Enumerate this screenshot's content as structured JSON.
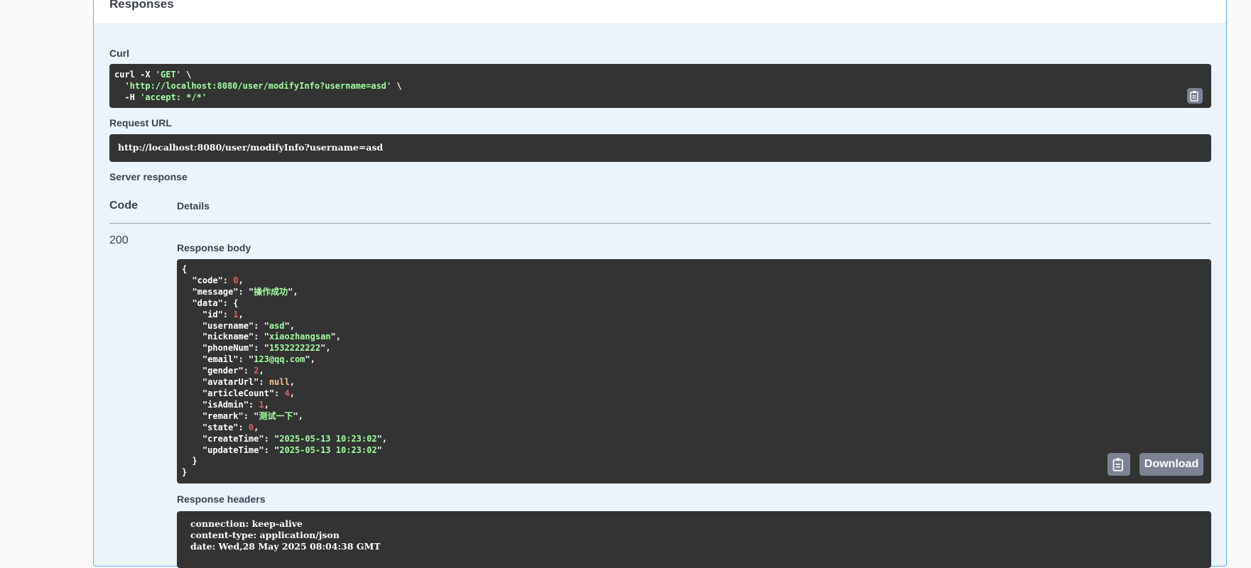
{
  "responses": {
    "title": "Responses"
  },
  "curl": {
    "label": "Curl",
    "line1_cmd": "curl -X ",
    "line1_method": "'GET'",
    "line1_tail": " \\",
    "line2_url": "'http://localhost:8080/user/modifyInfo?username=asd'",
    "line2_tail": " \\",
    "line3_flag": "  -H ",
    "line3_header": "'accept: */*'"
  },
  "request_url": {
    "label": "Request URL",
    "value": "http://localhost:8080/user/modifyInfo?username=asd"
  },
  "server_response": {
    "label": "Server response",
    "col_code": "Code",
    "col_details": "Details",
    "code": "200",
    "body_label": "Response body",
    "headers_label": "Response headers",
    "download_label": "Download"
  },
  "body": {
    "code": 0,
    "message": "操作成功",
    "data": {
      "id": 1,
      "username": "asd",
      "nickname": "xiaozhangsan",
      "phoneNum": "1532222222",
      "email": "123@qq.com",
      "gender": 2,
      "avatarUrl": "null",
      "articleCount": 4,
      "isAdmin": 1,
      "remark": "测试一下",
      "state": 0,
      "createTime": "2025-05-13 10:23:02",
      "updateTime": "2025-05-13 10:23:02"
    }
  },
  "headers": [
    "connection: keep-alive",
    "content-type: application/json",
    "date: Wed,28 May 2025 08:04:38 GMT"
  ],
  "icons": {
    "copy": "clipboard-icon"
  }
}
